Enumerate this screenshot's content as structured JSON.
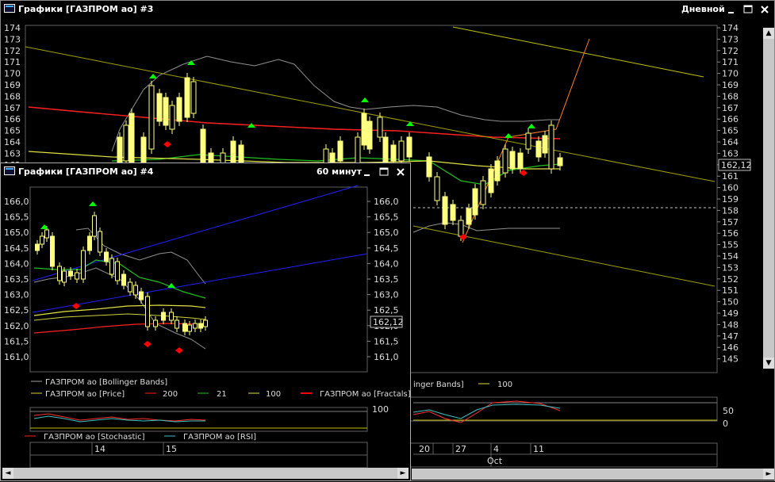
{
  "win3": {
    "title": "Графики [ГАЗПРОМ ао] #3",
    "timeframe": "Дневной",
    "price_label": "162,12",
    "y_ticks": [
      "174",
      "173",
      "172",
      "171",
      "170",
      "169",
      "168",
      "167",
      "166",
      "165",
      "164",
      "163",
      "162",
      "161",
      "160",
      "159",
      "158",
      "157",
      "156",
      "155",
      "154",
      "153",
      "152",
      "151",
      "150",
      "149",
      "148",
      "147",
      "146",
      "145"
    ],
    "legend_tail": "inger Bands]",
    "legend_100": "100",
    "osc_ticks": [
      "50",
      "0"
    ],
    "x_labels": [
      "20",
      "27",
      "4",
      "11"
    ],
    "x_month": "Oct"
  },
  "win4": {
    "title": "Графики [ГАЗПРОМ ао] #4",
    "timeframe": "60 минут",
    "price_label": "162,12",
    "y_ticks": [
      "166,0",
      "165,5",
      "165,0",
      "164,5",
      "164,0",
      "163,5",
      "163,0",
      "162,5",
      "162,0",
      "161,5",
      "161,0"
    ],
    "legend": {
      "bollinger": "ГАЗПРОМ ао [Bollinger Bands]",
      "price": "ГАЗПРОМ ао [Price]",
      "ma200": "200",
      "ma21": "21",
      "ma100": "100",
      "fractals": "ГАЗПРОМ ао [Fractals]",
      "stochastic": "ГАЗПРОМ ао [Stochastic]",
      "rsi": "ГАЗПРОМ ао [RSI]"
    },
    "osc_tick": "100",
    "x_labels": [
      "14",
      "15"
    ]
  },
  "colors": {
    "candle": "#ffff80",
    "ma200": "#ff2020",
    "ma21": "#20c020",
    "ma100": "#ffff40",
    "bollinger": "#a0a0a0",
    "fractal_up": "#00ff00",
    "fractal_down": "#ff0000",
    "trend_yellow": "#c0c000",
    "trend_blue": "#2020ff",
    "trend_orange": "#ff8020"
  },
  "icons": {
    "minimize": "minimize-icon",
    "maximize": "maximize-icon",
    "close": "close-icon"
  }
}
